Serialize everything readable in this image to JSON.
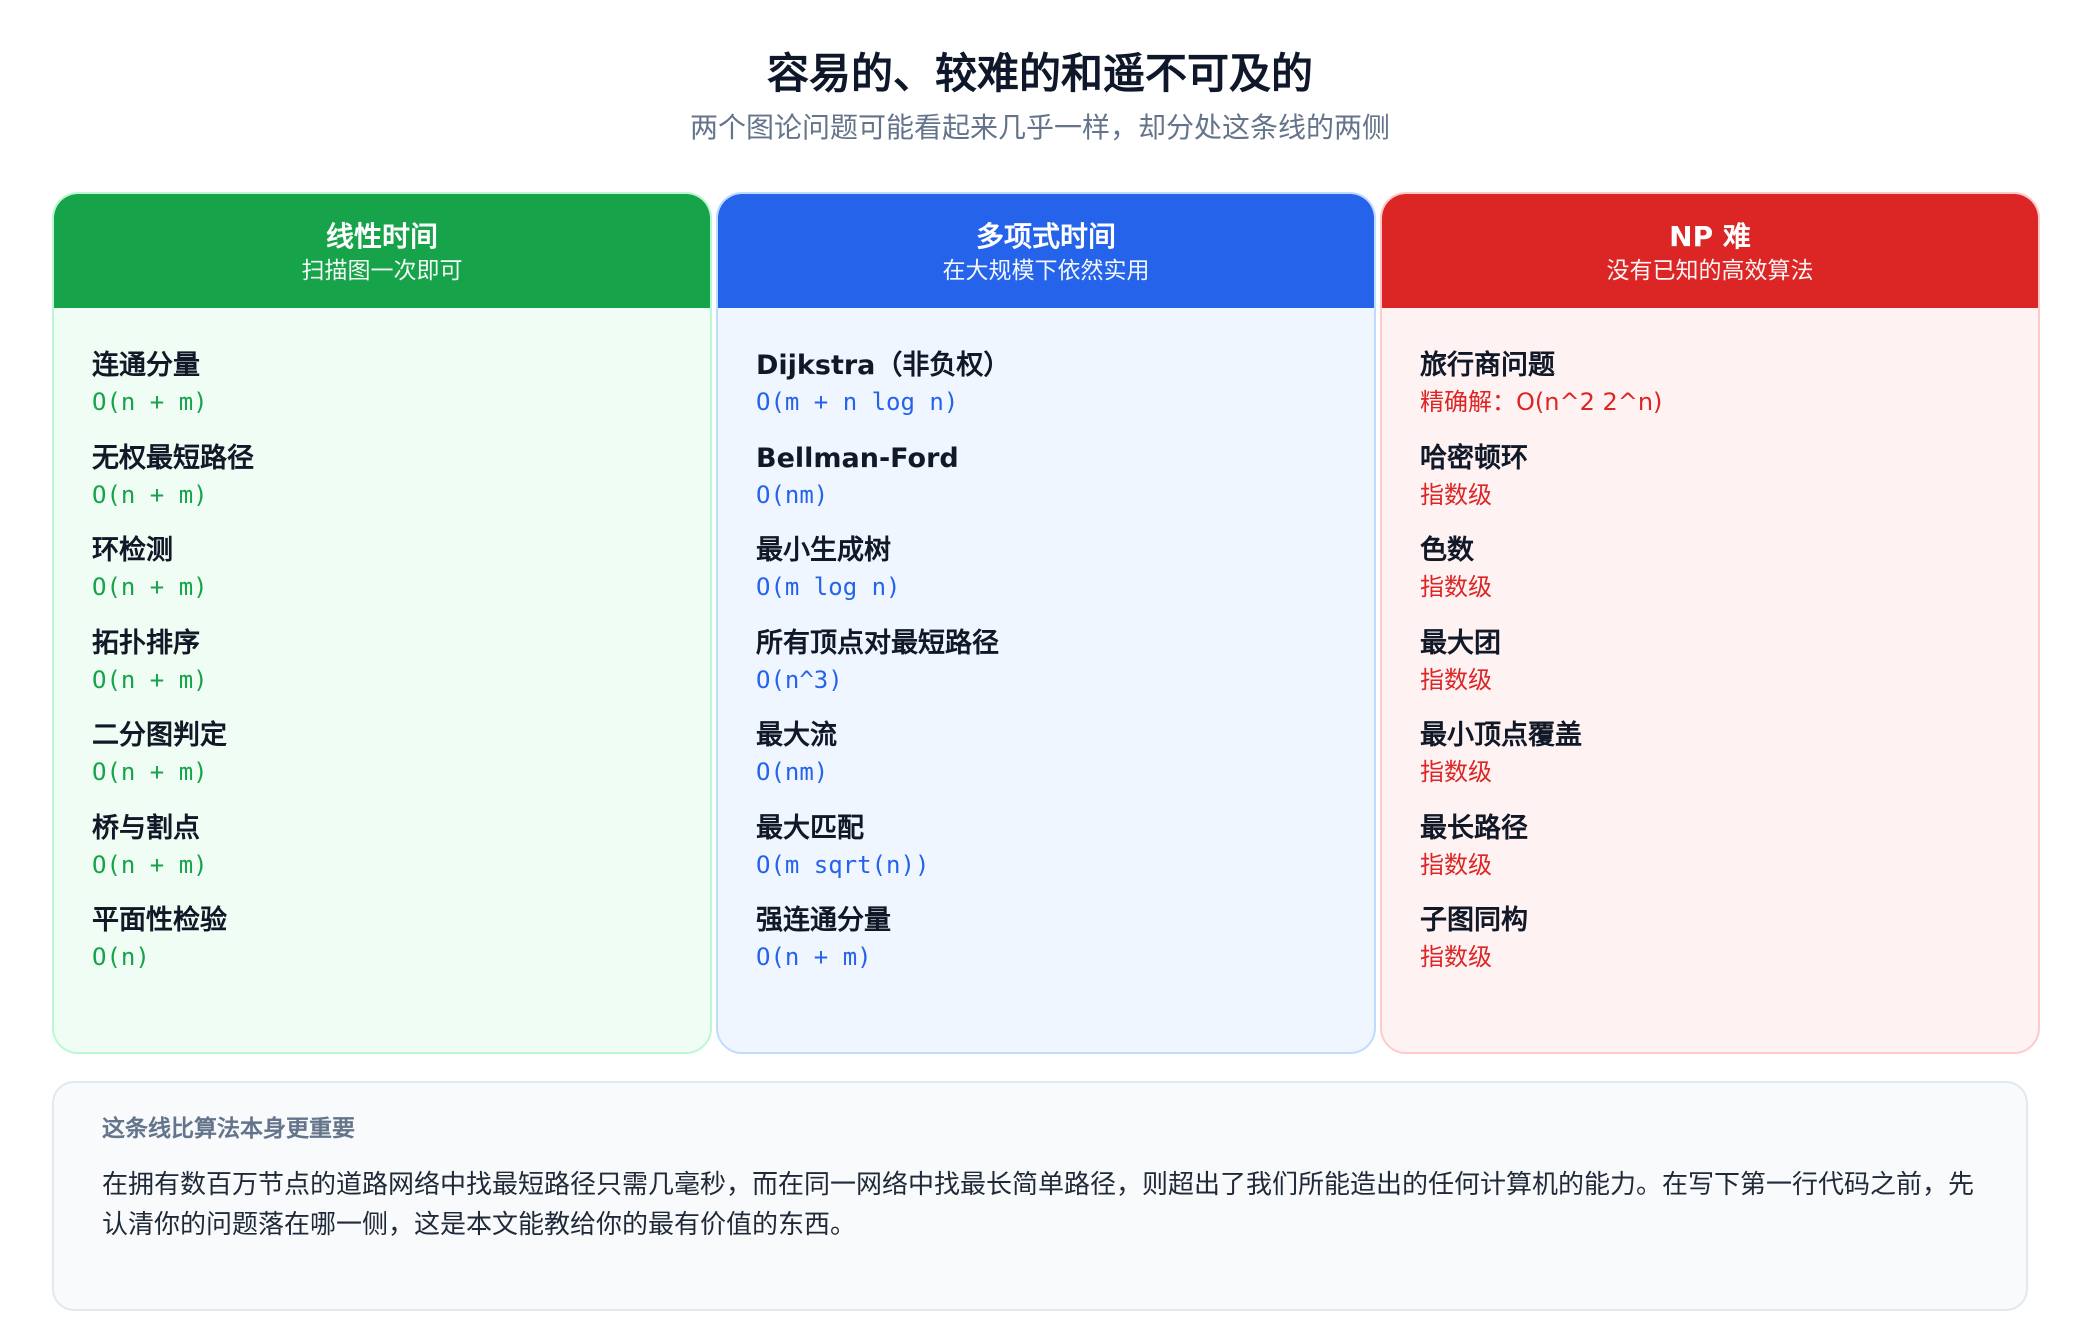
{
  "header": {
    "title": "容易的、较难的和遥不可及的",
    "subtitle": "两个图论问题可能看起来几乎一样，却分处这条线的两侧"
  },
  "columns": [
    {
      "title": "线性时间",
      "subtitle": "扫描图一次即可",
      "accent_color": "#16a34a",
      "body_color": "#f0fdf4",
      "border_color": "#bbf7d0",
      "complexity_color": "#16a34a",
      "items": [
        {
          "name": "连通分量",
          "complexity": "O(n + m)"
        },
        {
          "name": "无权最短路径",
          "complexity": "O(n + m)"
        },
        {
          "name": "环检测",
          "complexity": "O(n + m)"
        },
        {
          "name": "拓扑排序",
          "complexity": "O(n + m)"
        },
        {
          "name": "二分图判定",
          "complexity": "O(n + m)"
        },
        {
          "name": "桥与割点",
          "complexity": "O(n + m)"
        },
        {
          "name": "平面性检验",
          "complexity": "O(n)"
        }
      ]
    },
    {
      "title": "多项式时间",
      "subtitle": "在大规模下依然实用",
      "accent_color": "#2563eb",
      "body_color": "#eff6ff",
      "border_color": "#bfdbfe",
      "complexity_color": "#2563eb",
      "items": [
        {
          "name": "Dijkstra（非负权）",
          "complexity": "O(m + n log n)"
        },
        {
          "name": "Bellman-Ford",
          "complexity": "O(nm)"
        },
        {
          "name": "最小生成树",
          "complexity": "O(m log n)"
        },
        {
          "name": "所有顶点对最短路径",
          "complexity": "O(n^3)"
        },
        {
          "name": "最大流",
          "complexity": "O(nm)"
        },
        {
          "name": "最大匹配",
          "complexity": "O(m sqrt(n))"
        },
        {
          "name": "强连通分量",
          "complexity": "O(n + m)"
        }
      ]
    },
    {
      "title": "NP 难",
      "subtitle": "没有已知的高效算法",
      "accent_color": "#dc2626",
      "body_color": "#fef2f2",
      "border_color": "#fecaca",
      "complexity_color": "#dc2626",
      "items": [
        {
          "name": "旅行商问题",
          "complexity": "精确解：O(n^2 2^n)"
        },
        {
          "name": "哈密顿环",
          "complexity": "指数级"
        },
        {
          "name": "色数",
          "complexity": "指数级"
        },
        {
          "name": "最大团",
          "complexity": "指数级"
        },
        {
          "name": "最小顶点覆盖",
          "complexity": "指数级"
        },
        {
          "name": "最长路径",
          "complexity": "指数级"
        },
        {
          "name": "子图同构",
          "complexity": "指数级"
        }
      ]
    }
  ],
  "note": {
    "title": "这条线比算法本身更重要",
    "body": "在拥有数百万节点的道路网络中找最短路径只需几毫秒，而在同一网络中找最长简单路径，则超出了我们所能造出的任何计算机的能力。在写下第一行代码之前，先认清你的问题落在哪一侧，这是本文能教给你的最有价值的东西。"
  }
}
